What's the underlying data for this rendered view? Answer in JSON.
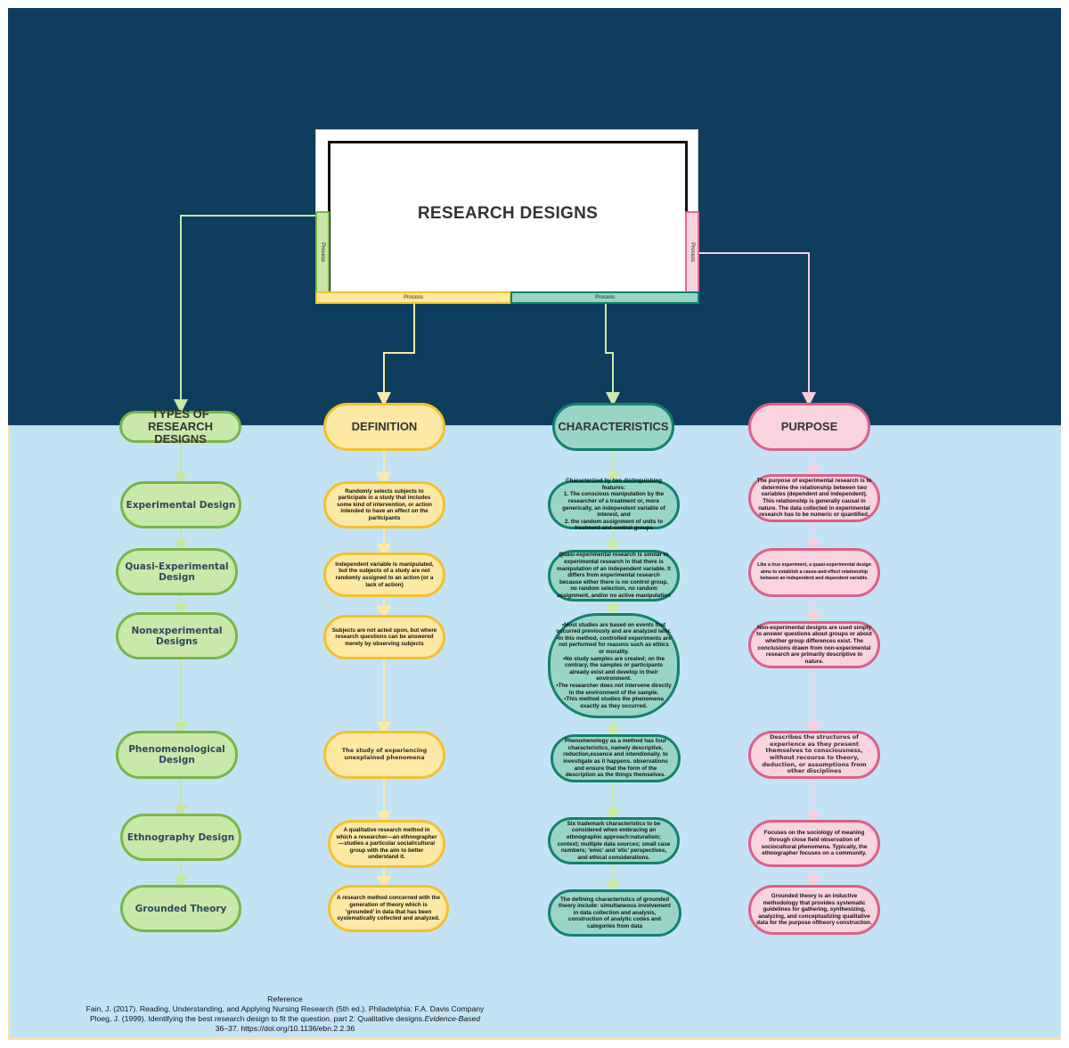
{
  "diagram": {
    "title": "RESEARCH DESIGNS",
    "process_labels": {
      "left": "Process",
      "right": "Process",
      "bottom_left": "Process",
      "bottom_right": "Process"
    },
    "colors": {
      "header_band": "#0f3d5e",
      "body_band": "#c3e3f5",
      "green": "#7ab648",
      "yellow": "#f5c02e",
      "teal": "#12826c",
      "pink": "#dc6088"
    },
    "columns": [
      {
        "heading": "TYPES OF RESEARCH DESIGNS",
        "heading_line1": "TYPES OF",
        "heading_line2": "RESEARCH DESIGNS",
        "items": [
          "Experimental Design",
          "Quasi-Experimental Design",
          "Nonexperimental Designs",
          "Phenomenological Design",
          "Ethnography Design",
          "Grounded Theory"
        ]
      },
      {
        "heading": "DEFINITION",
        "items": [
          "Randomly selects subjects to participate in a study that includes some kind of intervention, or action intended to have an effect on the participants",
          "Independent variable is manipulated, but the subjects of a study are not randomly assigned to an action (or a lack of action)",
          "Subjects are not acted upon, but where research questions can be answered merely by observing subjects",
          "The study of experiencing unexplained phenomena",
          "A qualitative research method in which a researcher—an ethnographer—studies a particular social/cultural group with the aim to better understand it.",
          "A research method concerned with the generation of theory which is ‘grounded’ in data that has been systematically collected and analyzed."
        ]
      },
      {
        "heading": "CHARACTERISTICS",
        "items": [
          "Characterized by two distinguishing features:\n1. The conscious manipulation by the researcher of a treatment or, more generically, an independent variable of interest, and\n2. the random assignment of units to treatment and control groups",
          "Quasi-experimental research is similar to experimental research in that there is manipulation of an independent variable. It differs from experimental research because either there is no control group, no random selection, no random assignment, and/or no active manipulation",
          "•Most studies are based on events that occurred previously and are analyzed later.\n•In this method, controlled experiments are not performed for reasons such as ethics or morality.\n•No study samples are created; on the contrary, the samples or participants already exist and develop in their environment.\n•The researcher does not intervene directly in the environment of the sample.\n•This method studies the phenomena exactly as they occurred.",
          "Phenomenology as a method has four characteristics, namely descriptive, reduction,essence and intendionally. to investigate as it happens. observations and ensure that the form of the description as the things themselves.",
          "Six trademark characteristics to be considered when embracing an ethnographic approach:naturalism; context; multiple data sources; small case numbers; 'emic' and 'etic' perspectives, and ethical considerations.",
          "The defining characteristics of grounded theory include: simultaneous involvement in data collection and analysis, construction of analytic codes and categories from data"
        ]
      },
      {
        "heading": "PURPOSE",
        "items": [
          "The purpose of experimental research is to determine the relationship between two variables (dependent and independent). This relationship is generally causal in nature. The data collected in experimental research has to be numeric or quantified.",
          "Like a true experiment, a quasi-experimental design aims to establish a cause-and-effect relationship between an independent and dependent variable.",
          "Non-experimental designs are used simply to answer questions about groups or about whether group differences exist. The conclusions drawn from non-experimental research are primarily descriptive in nature.",
          "Describes the structures of experience as they present themselves to consciousness, without recourse to theory, deduction, or assumptions from other disciplines",
          "Focuses on the sociology of meaning through close field observation of sociocultural phenomena. Typically, the ethnographer focuses on a community.",
          "Grounded theory is an inductive methodology that provides systematic guidelines for gathering, synthesizing, analyzing, and conceptualizing qualitative data for the purpose oftheory construction."
        ]
      }
    ]
  },
  "reference": {
    "title": "Reference",
    "line1": "Fain, J. (2017). Reading, Understanding, and Applying Nursing  Research (5th ed.). Philadelphia: F.A. Davis Company",
    "line2_prefix": "Ploeg, J. (1999). Identifying the best research design to fit the question. part 2: Qualitative designs.",
    "line2_italic": "Evidence-Based",
    "line3": "36–37. https://doi.org/10.1136/ebn.2.2.36"
  }
}
